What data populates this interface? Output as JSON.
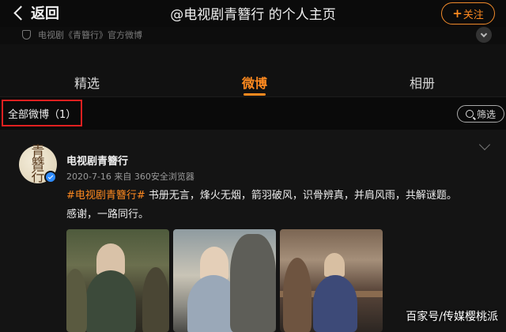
{
  "header": {
    "back_label": "返回",
    "title": "@电视剧青簪行 的个人主页",
    "follow_label": "关注"
  },
  "verification": {
    "text": "电视剧《青簪行》官方微博"
  },
  "tabs": [
    {
      "label": "精选"
    },
    {
      "label": "微博"
    },
    {
      "label": "相册"
    }
  ],
  "filter_bar": {
    "all_posts_label": "全部微博（1）",
    "filter_label": "筛选"
  },
  "post": {
    "avatar_text": "青簪行",
    "author": "电视剧青簪行",
    "meta": "2020-7-16  来自 360安全浏览器",
    "hashtag": "#电视剧青簪行#",
    "text_rest": " 书册无言，烽火无烟，箭羽破风，识骨辨真，并肩风雨，共解谜题。",
    "text_line2": "感谢，一路同行。",
    "images": [
      {
        "alt": "drama still 1"
      },
      {
        "alt": "drama still 2"
      },
      {
        "alt": "drama still 3"
      }
    ]
  },
  "watermark": "百家号/传媒樱桃派",
  "colors": {
    "accent": "#ff8a1f",
    "highlight_box": "#e02020",
    "verified": "#2f8cff"
  }
}
